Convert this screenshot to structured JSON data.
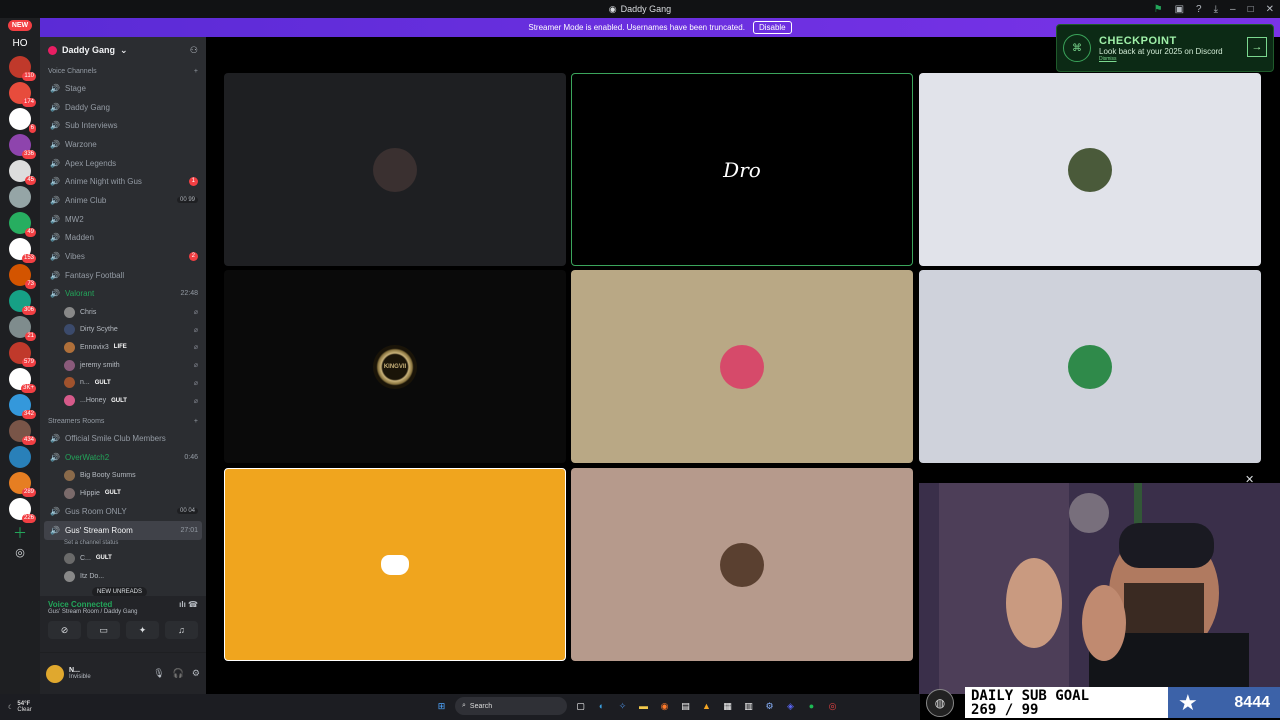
{
  "window": {
    "title": "Daddy Gang"
  },
  "banner": {
    "text": "Streamer Mode is enabled. Usernames have been truncated.",
    "button": "Disable"
  },
  "rail": {
    "new_label": "NEW",
    "home_label": "HO",
    "servers": [
      {
        "color": "#c0392b",
        "badge": "110"
      },
      {
        "color": "#e74c3c",
        "badge": "174"
      },
      {
        "color": "#ffffff",
        "badge": "6"
      },
      {
        "color": "#8e44ad",
        "badge": "336"
      },
      {
        "color": "#dddddd",
        "badge": "45"
      },
      {
        "color": "#95a5a6",
        "badge": ""
      },
      {
        "color": "#27ae60",
        "badge": "49"
      },
      {
        "color": "#ffffff",
        "badge": "153"
      },
      {
        "color": "#d35400",
        "badge": "73"
      },
      {
        "color": "#16a085",
        "badge": "306"
      },
      {
        "color": "#7f8c8d",
        "badge": "21"
      },
      {
        "color": "#c0392b",
        "badge": "579"
      },
      {
        "color": "#ffffff",
        "badge": "3K+"
      },
      {
        "color": "#3498db",
        "badge": "342"
      },
      {
        "color": "#795548",
        "badge": "434"
      },
      {
        "color": "#2980b9",
        "badge": ""
      },
      {
        "color": "#e67e22",
        "badge": "289"
      },
      {
        "color": "#ffffff",
        "badge": "226"
      }
    ]
  },
  "guild": {
    "name": "Daddy Gang"
  },
  "voice_category": "Voice Channels",
  "channels": [
    {
      "name": "Stage",
      "badge": "",
      "right": ""
    },
    {
      "name": "Daddy Gang",
      "badge": "",
      "right": ""
    },
    {
      "name": "Sub Interviews",
      "badge": "",
      "right": ""
    },
    {
      "name": "Warzone",
      "badge": "",
      "right": ""
    },
    {
      "name": "Apex Legends",
      "badge": "",
      "right": ""
    },
    {
      "name": "Anime Night with Gus",
      "badge": "1",
      "right": ""
    },
    {
      "name": "Anime Club",
      "badge": "",
      "right": "00 99"
    },
    {
      "name": "MW2",
      "badge": "",
      "right": ""
    },
    {
      "name": "Madden",
      "badge": "",
      "right": ""
    },
    {
      "name": "Vibes",
      "badge": "2",
      "right": ""
    },
    {
      "name": "Fantasy Football",
      "badge": "",
      "right": ""
    }
  ],
  "valorant": {
    "name": "Valorant",
    "time": "22:48",
    "members": [
      {
        "name": "Chris",
        "tag": "",
        "color": "#888"
      },
      {
        "name": "Dirty Scythe",
        "tag": "",
        "color": "#3b4a6b"
      },
      {
        "name": "Ennovix3",
        "tag": "LIFE",
        "color": "#b0703a"
      },
      {
        "name": "jeremy smith",
        "tag": "",
        "color": "#8a5a7a"
      },
      {
        "name": "n...",
        "tag": "GULT",
        "color": "#a0522d"
      },
      {
        "name": "...Honey",
        "tag": "GULT",
        "color": "#d65a8a"
      }
    ]
  },
  "streamers_category": "Streamers Rooms",
  "official_room": "Official Smile Club Members",
  "overwatch": {
    "name": "OverWatch2",
    "time": "0:46",
    "members": [
      {
        "name": "Big Booty Summs",
        "tag": "",
        "color": "#8a6a4a"
      },
      {
        "name": "Hippie",
        "tag": "GULT",
        "color": "#7a6a6a"
      }
    ]
  },
  "gus_room_only": {
    "name": "Gus Room ONLY",
    "right": "00 04"
  },
  "gus_stream": {
    "name": "Gus' Stream Room",
    "time": "27:01",
    "status": "Set a channel status",
    "members": [
      {
        "name": "C...",
        "tag": "GULT",
        "color": "#6a6a6a"
      },
      {
        "name": "Itz Do...",
        "tag": "",
        "color": "#888"
      }
    ]
  },
  "new_unreads": "NEW UNREADS",
  "voice_connected": {
    "title": "Voice Connected",
    "sub": "Gus' Stream Room / Daddy Gang"
  },
  "user": {
    "name": "N...",
    "status": "Invisible"
  },
  "tiles": [
    {
      "bg": "#1e1f22",
      "border": "none",
      "avatar": "#3a3030"
    },
    {
      "bg": "#000000",
      "border": "1px solid #3ba55c",
      "avatar": "",
      "logo": "Dro"
    },
    {
      "bg": "#e1e3ea",
      "border": "none",
      "avatar": "#4a5a3a"
    },
    {
      "bg": "#0a0a0a",
      "border": "none",
      "avatar": "#c9b27a",
      "logo": "KINGVII"
    },
    {
      "bg": "#b9a885",
      "border": "none",
      "avatar": "#d64a6a"
    },
    {
      "bg": "#cfd2db",
      "border": "none",
      "avatar": "#2f8a4a"
    },
    {
      "bg": "#f0a51e",
      "border": "1px solid #ffffff",
      "avatar": "",
      "logo": "discord"
    },
    {
      "bg": "#b69a8c",
      "border": "none",
      "avatar": "#5a4030"
    }
  ],
  "checkpoint": {
    "title": "CHECKPOINT",
    "sub": "Look back at your 2025 on Discord",
    "dismiss": "Dismiss"
  },
  "overlay": {
    "goal_title": "DAILY SUB GOAL",
    "goal_value": "269 / 99",
    "count": "8444"
  },
  "taskbar": {
    "temp": "54°F",
    "cond": "Clear",
    "search": "Search"
  }
}
